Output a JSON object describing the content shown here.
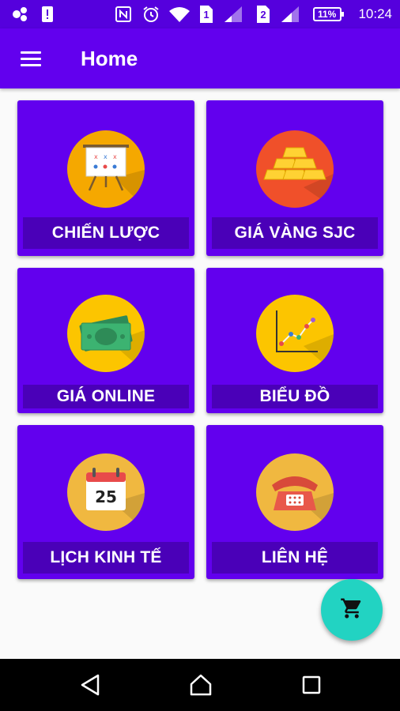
{
  "status_bar": {
    "sim1": "1",
    "sim2": "2",
    "battery": "11%",
    "time": "10:24",
    "icons": [
      "apps-icon",
      "alert-icon",
      "nfc-icon",
      "alarm-icon",
      "wifi-icon",
      "sim-icon",
      "signal-icon",
      "battery-icon"
    ]
  },
  "app_bar": {
    "title": "Home",
    "menu_icon": "hamburger-menu-icon"
  },
  "tiles": [
    {
      "label": "CHIẾN LƯỢC",
      "icon": "strategy-board-icon",
      "circle_color": "#f5a800"
    },
    {
      "label": "GIÁ VÀNG SJC",
      "icon": "gold-bars-icon",
      "circle_color": "#f0502a"
    },
    {
      "label": "GIÁ ONLINE",
      "icon": "money-icon",
      "circle_color": "#fcc500"
    },
    {
      "label": "BIỂU ĐỒ",
      "icon": "line-chart-icon",
      "circle_color": "#fcc500"
    },
    {
      "label": "LỊCH KINH TẾ",
      "icon": "calendar-icon",
      "circle_color": "#f0b840",
      "calendar_day": "25"
    },
    {
      "label": "LIÊN HỆ",
      "icon": "telephone-icon",
      "circle_color": "#f0b840"
    }
  ],
  "fab": {
    "icon": "shopping-cart-icon",
    "color": "#22d3c2"
  },
  "nav_bar": {
    "icons": [
      "back-icon",
      "home-icon",
      "recents-icon"
    ]
  },
  "colors": {
    "primary": "#6200ee",
    "status_bar": "#5500dd",
    "label_bg": "#4a00b8"
  }
}
